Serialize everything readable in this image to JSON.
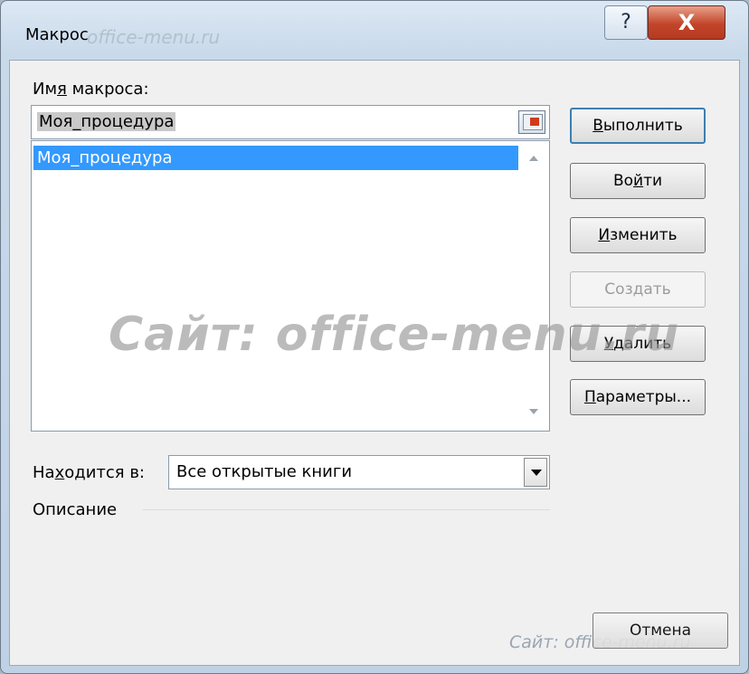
{
  "window": {
    "title": "Макрос",
    "title_watermark": "office-menu.ru",
    "help_glyph": "?",
    "close_glyph": "X"
  },
  "macro_name": {
    "label_pre": "Им",
    "label_u": "я",
    "label_post": " макроса:",
    "value": "Моя_процедура"
  },
  "macro_list": {
    "items": [
      "Моя_процедура"
    ],
    "selected_index": 0
  },
  "buttons": {
    "run": {
      "u": "В",
      "rest": "ыполнить"
    },
    "step_into": {
      "pre": "Во",
      "u": "й",
      "rest": "ти"
    },
    "edit": {
      "u": "И",
      "rest": "зменить"
    },
    "create": {
      "label": "Создать"
    },
    "delete": {
      "u": "У",
      "rest": "далить"
    },
    "options": {
      "u": "П",
      "rest": "араметры..."
    },
    "cancel": {
      "label": "Отмена"
    }
  },
  "location": {
    "label_pre": "На",
    "label_u": "х",
    "label_post": "одится в:",
    "value": "Все открытые книги"
  },
  "description": {
    "label": "Описание"
  },
  "watermarks": {
    "center": "Сайт: office-menu.ru",
    "bottom": "Сайт: office-menu.ru"
  }
}
